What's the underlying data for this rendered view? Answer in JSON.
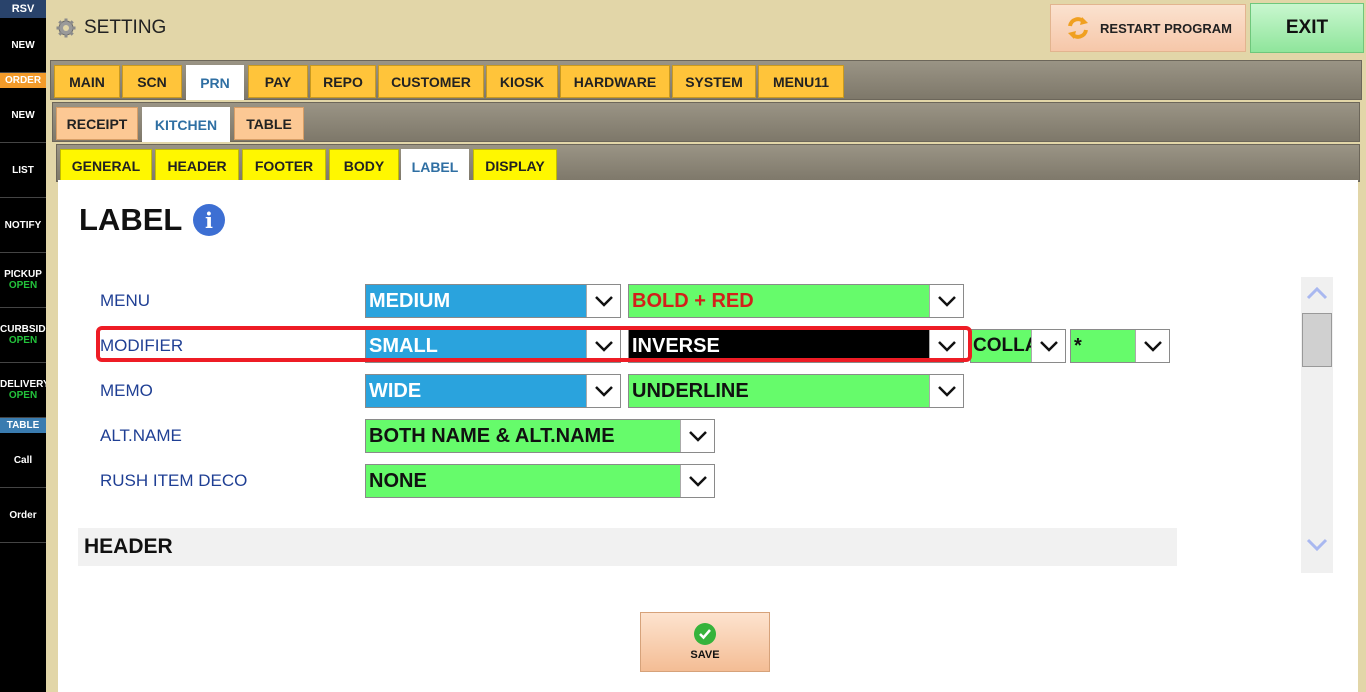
{
  "sidebar": {
    "rsv_header": "RSV",
    "rsv_new": "NEW",
    "order_header": "ORDER",
    "order_new": "NEW",
    "list": "LIST",
    "notify": "NOTIFY",
    "pickup": "PICKUP",
    "pickup_status": "OPEN",
    "curbside": "CURBSIDE",
    "curbside_status": "OPEN",
    "delivery": "DELIVERY",
    "delivery_status": "OPEN",
    "table_header": "TABLE",
    "call": "Call",
    "order": "Order"
  },
  "header": {
    "title": "SETTING",
    "restart_label": "RESTART PROGRAM",
    "exit_label": "EXIT"
  },
  "tabs_main": [
    "MAIN",
    "SCN",
    "PRN",
    "PAY",
    "REPO",
    "CUSTOMER",
    "KIOSK",
    "HARDWARE",
    "SYSTEM",
    "MENU11"
  ],
  "tabs_main_active": "PRN",
  "tabs_prn": [
    "RECEIPT",
    "KITCHEN",
    "TABLE"
  ],
  "tabs_prn_active": "KITCHEN",
  "tabs_kitchen": [
    "GENERAL",
    "HEADER",
    "FOOTER",
    "BODY",
    "LABEL",
    "DISPLAY"
  ],
  "tabs_kitchen_active": "LABEL",
  "page": {
    "title": "LABEL",
    "info_glyph": "i"
  },
  "rows": {
    "menu": {
      "label": "MENU",
      "size": "MEDIUM",
      "style": "BOLD + RED"
    },
    "modifier": {
      "label": "MODIFIER",
      "size": "SMALL",
      "style": "INVERSE",
      "collapse": "COLLAPSE",
      "mark": "*"
    },
    "memo": {
      "label": "MEMO",
      "size": "WIDE",
      "style": "UNDERLINE"
    },
    "alt_name": {
      "label": "ALT.NAME",
      "value": "BOTH NAME & ALT.NAME"
    },
    "rush": {
      "label": "RUSH ITEM DECO",
      "value": "NONE"
    }
  },
  "section_header": "HEADER",
  "save_label": "SAVE",
  "colors": {
    "blue_select": "#2aa3dd",
    "green_select": "#66fb6b",
    "highlight": "#ee1c25",
    "tab_yellow": "#ffc43a"
  }
}
